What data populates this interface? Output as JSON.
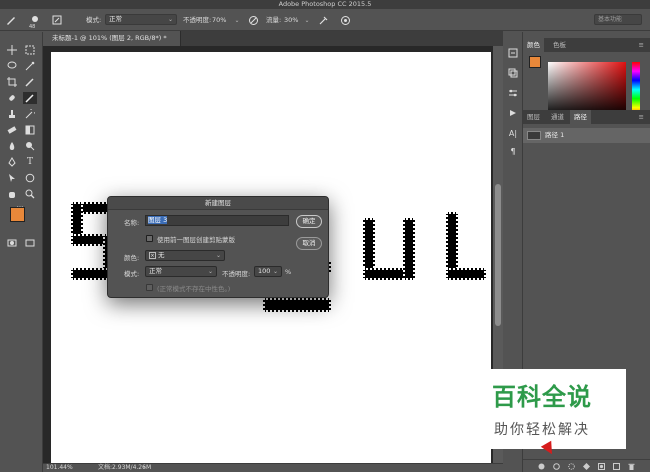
{
  "app": {
    "title": "Adobe Photoshop CC 2015.5"
  },
  "options_bar": {
    "brush_size": "48",
    "mode_label": "模式:",
    "mode_value": "正常",
    "opacity_label": "不透明度:",
    "opacity_value": "70%",
    "flow_label": "流量:",
    "flow_value": "30%",
    "workspace_search": "基本功能"
  },
  "document": {
    "tab_title": "未标题-1 @ 101% (图层 2, RGB/8*) *",
    "zoom": "101.44%",
    "doc_size": "文档:2.93M/4.26M"
  },
  "panels": {
    "color_tabs": [
      "颜色",
      "色板"
    ],
    "layer_tabs": [
      "图层",
      "通道",
      "路径"
    ],
    "path_item": "路径 1",
    "colors": {
      "foreground": "#e8883a",
      "background": "#ffffff"
    }
  },
  "dialog": {
    "title": "新建图层",
    "name_label": "名称:",
    "name_value": "图层 3",
    "clip_checkbox_label": "使用前一图层创建剪贴蒙版",
    "color_label": "颜色:",
    "color_value": "无",
    "mode_label": "模式:",
    "mode_value": "正常",
    "opacity_label": "不透明度:",
    "opacity_value": "100",
    "opacity_unit": "%",
    "neutral_label": "(正常模式不存在中性色。)",
    "ok_button": "确定",
    "cancel_button": "取消"
  },
  "watermark": {
    "title": "百科全说",
    "subtitle": "助你轻松解决"
  }
}
